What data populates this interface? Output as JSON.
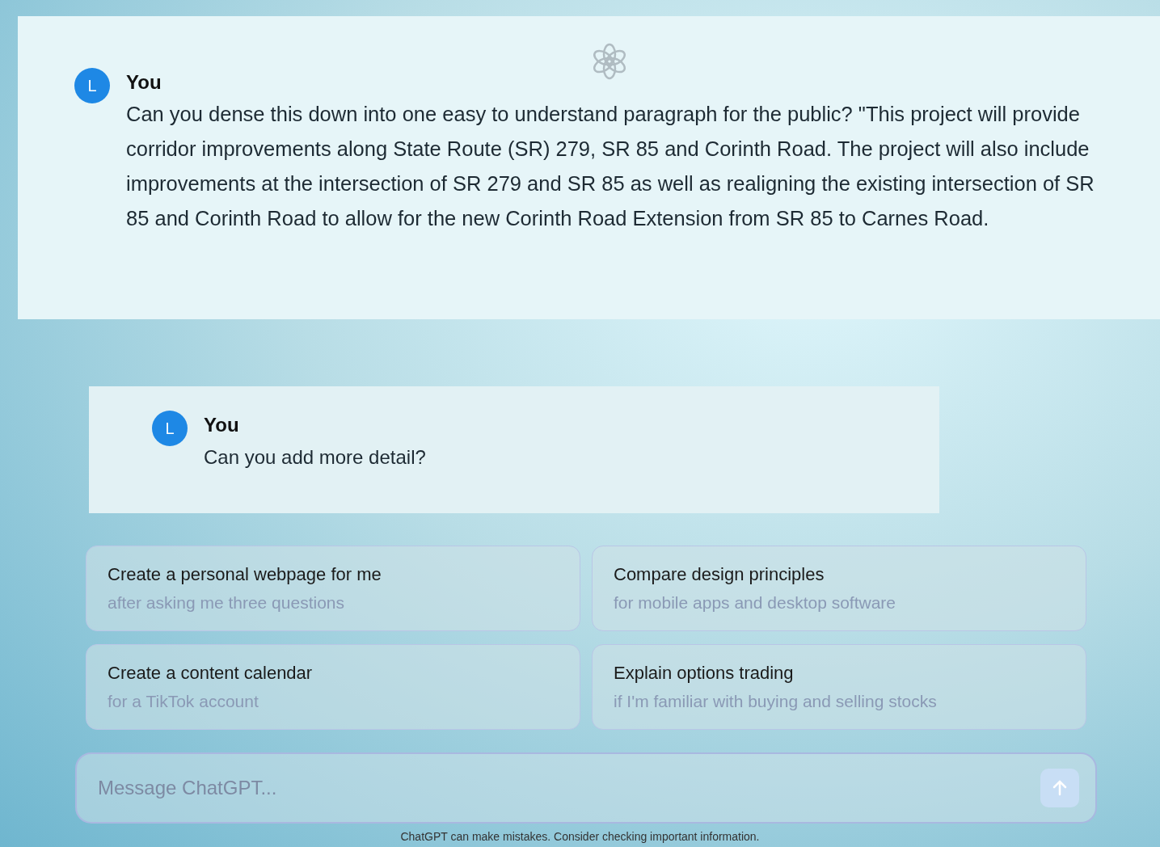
{
  "conversation": [
    {
      "author": "You",
      "avatar": "L",
      "text": "Can you dense this down into one easy to understand paragraph for the public? \"This project will provide corridor improvements along State Route (SR) 279, SR 85 and Corinth Road. The project will also include improvements at the intersection of SR 279 and SR 85 as well as realigning the existing intersection of SR 85 and Corinth Road to allow for the new Corinth Road Extension from SR 85 to Carnes Road."
    },
    {
      "author": "You",
      "avatar": "L",
      "text": "Can you add more detail?"
    }
  ],
  "suggestions": [
    {
      "title": "Create a personal webpage for me",
      "subtitle": "after asking me three questions"
    },
    {
      "title": "Compare design principles",
      "subtitle": "for mobile apps and desktop software"
    },
    {
      "title": "Create a content calendar",
      "subtitle": "for a TikTok account"
    },
    {
      "title": "Explain options trading",
      "subtitle": "if I'm familiar with buying and selling stocks"
    }
  ],
  "composer": {
    "placeholder": "Message ChatGPT...",
    "send_disabled": true
  },
  "footer": "ChatGPT can make mistakes. Consider checking important information."
}
